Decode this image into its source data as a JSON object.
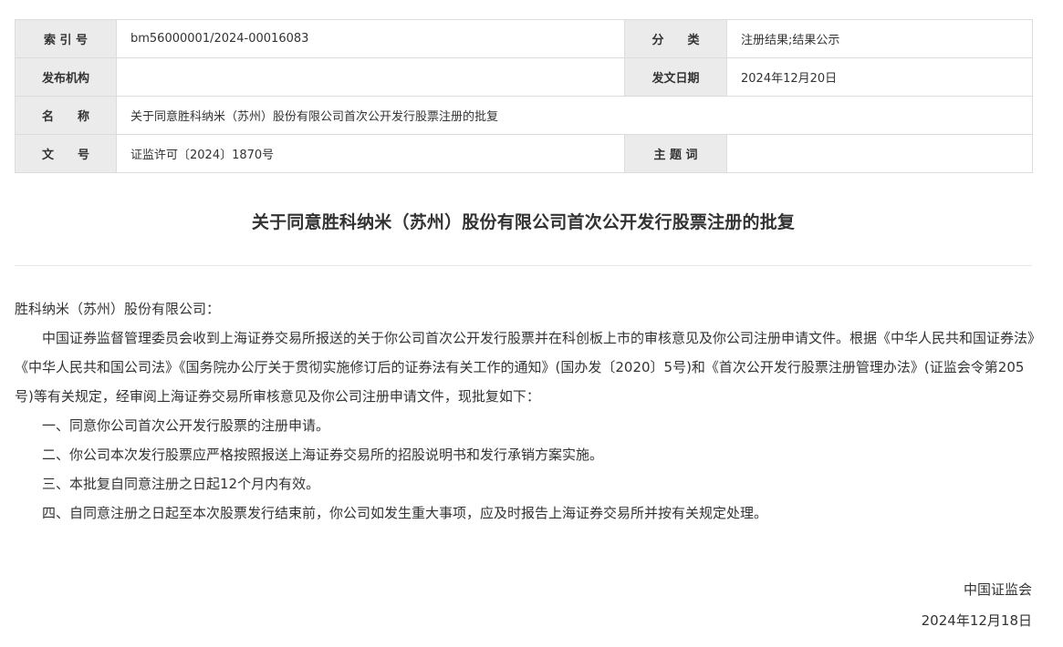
{
  "meta": {
    "index_label": "索 引 号",
    "index_value": "bm56000001/2024-00016083",
    "category_label": "分　　类",
    "category_value": "注册结果;结果公示",
    "publisher_label": "发布机构",
    "publisher_value": "",
    "date_label": "发文日期",
    "date_value": "2024年12月20日",
    "name_label": "名　　称",
    "name_value": "关于同意胜科纳米（苏州）股份有限公司首次公开发行股票注册的批复",
    "docno_label": "文　　号",
    "docno_value": "证监许可〔2024〕1870号",
    "keyword_label": "主 题 词",
    "keyword_value": ""
  },
  "title": "关于同意胜科纳米（苏州）股份有限公司首次公开发行股票注册的批复",
  "body": {
    "salutation": "胜科纳米（苏州）股份有限公司：",
    "intro": "中国证券监督管理委员会收到上海证券交易所报送的关于你公司首次公开发行股票并在科创板上市的审核意见及你公司注册申请文件。根据《中华人民共和国证券法》《中华人民共和国公司法》《国务院办公厅关于贯彻实施修订后的证券法有关工作的通知》(国办发〔2020〕5号)和《首次公开发行股票注册管理办法》(证监会令第205号)等有关规定，经审阅上海证券交易所审核意见及你公司注册申请文件，现批复如下：",
    "items": [
      "一、同意你公司首次公开发行股票的注册申请。",
      "二、你公司本次发行股票应严格按照报送上海证券交易所的招股说明书和发行承销方案实施。",
      "三、本批复自同意注册之日起12个月内有效。",
      "四、自同意注册之日起至本次股票发行结束前，你公司如发生重大事项，应及时报告上海证券交易所并按有关规定处理。"
    ]
  },
  "signature": {
    "org": "中国证监会",
    "date": "2024年12月18日"
  }
}
